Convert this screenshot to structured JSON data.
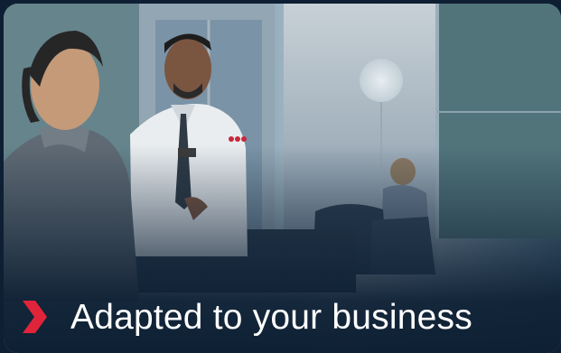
{
  "card": {
    "caption": "Adapted to your business",
    "accent_color": "#e0243a",
    "icon": "chevron-right-icon"
  },
  "photo": {
    "icon": "people-at-reception-photo"
  }
}
